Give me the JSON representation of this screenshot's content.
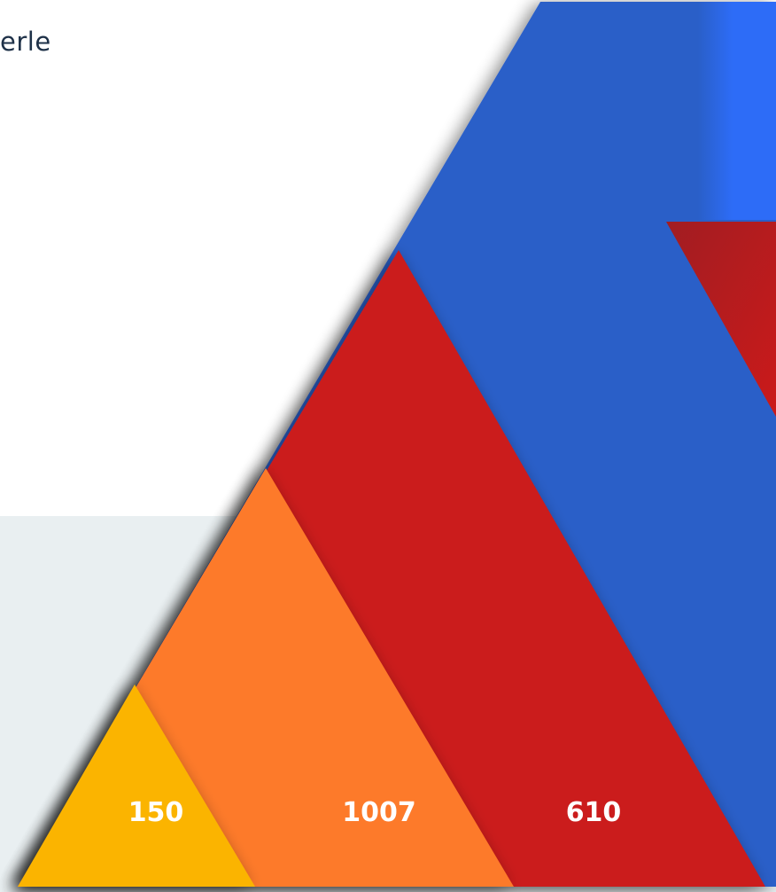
{
  "heading": "erle",
  "colors": {
    "yellow": "#fbb406",
    "orange": "#fd7a2a",
    "red": "#cb1a1a",
    "blue": "#2a5fc8",
    "blue_light": "#2d6cf7",
    "label": "#ffffff"
  },
  "labels": {
    "yellow": "150",
    "orange": "1007",
    "red": "610"
  }
}
